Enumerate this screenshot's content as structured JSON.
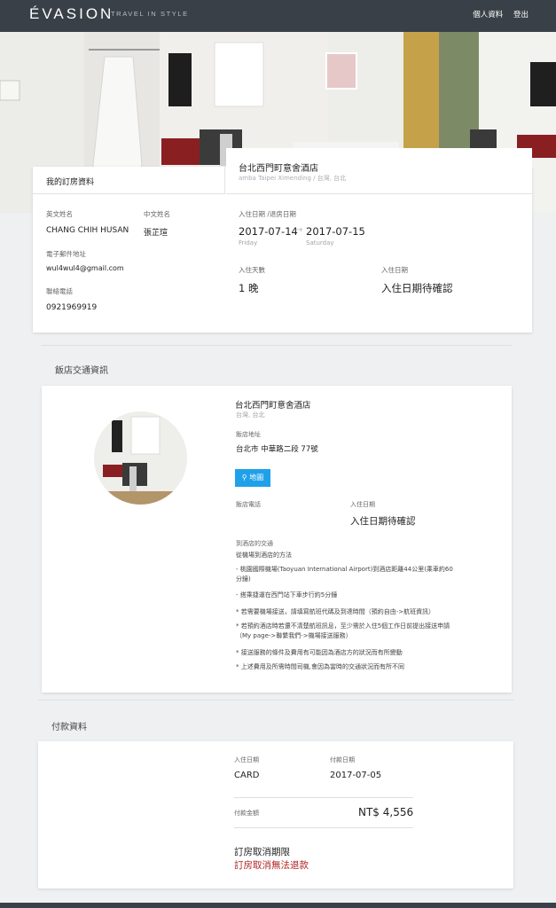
{
  "header": {
    "logo": "ÉVASION",
    "tagline": "TRAVEL IN STYLE",
    "nav": [
      "個人資料",
      "登出"
    ]
  },
  "booking": {
    "tab_label": "我的訂房資料",
    "hotel_name": "台北西門町意舍酒店",
    "hotel_subtitle": "amba Taipei Ximending / 台灣, 台北",
    "en_name_label": "英文姓名",
    "en_name": "CHANG CHIH HUSAN",
    "zh_name_label": "中文姓名",
    "zh_name": "張芷瑄",
    "email_label": "電子郵件地址",
    "email": "wul4wul4@gmail.com",
    "phone_label": "聯絡電話",
    "phone": "0921969919",
    "dates_label": "入住日期 /退房日期",
    "checkin_date": "2017-07-14",
    "checkin_day": "Friday",
    "arrow": "→",
    "checkout_date": "2017-07-15",
    "checkout_day": "Saturday",
    "nights_label": "入住天數",
    "nights": "1 晚",
    "checkin_label": "入住日期",
    "checkin_status": "入住日期待確認"
  },
  "transport": {
    "section_title": "飯店交通資訊",
    "hotel_name": "台北西門町意舍酒店",
    "location": "台灣, 台北",
    "address_label": "飯店地址",
    "address": "台北市 中華路二段 77號",
    "map_button": "地圖",
    "phone_label": "飯店電話",
    "checkin_label": "入住日期",
    "checkin_status": "入住日期待確認",
    "transport_label": "到酒店的交通",
    "airport_title": "從機場到酒店的方法",
    "notes": [
      "- 桃園國際機場(Taoyuan International Airport)到酒店距離44公里(乘車約60分鐘)",
      "- 搭乘捷運在西門站下車步行約5分鐘",
      "* 若需要機場接送，請填寫航班代碼及到達時間（預約自由->航班資訊）",
      "* 若預約酒店時若還不清楚航班訊息，至少需於入住5個工作日前提出接送申請（My page->聯繫我們->機場接送服務）",
      "* 接送服務的條件及費用有可能因為酒店方的狀況而有所變動",
      "* 上述費用及所需時間司機,會因為當時的交通狀況而有所不同"
    ]
  },
  "payment": {
    "section_title": "付款資料",
    "method_label": "入住日期",
    "method": "CARD",
    "date_label": "付款日期",
    "date": "2017-07-05",
    "amount_label": "付款金額",
    "amount": "NT$ 4,556",
    "cancel_title": "訂房取消期限",
    "cancel_policy": "訂房取消無法退款"
  },
  "colors": {
    "header_bg": "#3a4047",
    "map_button": "#1fa1ea",
    "cancel_red": "#b01f1f"
  }
}
